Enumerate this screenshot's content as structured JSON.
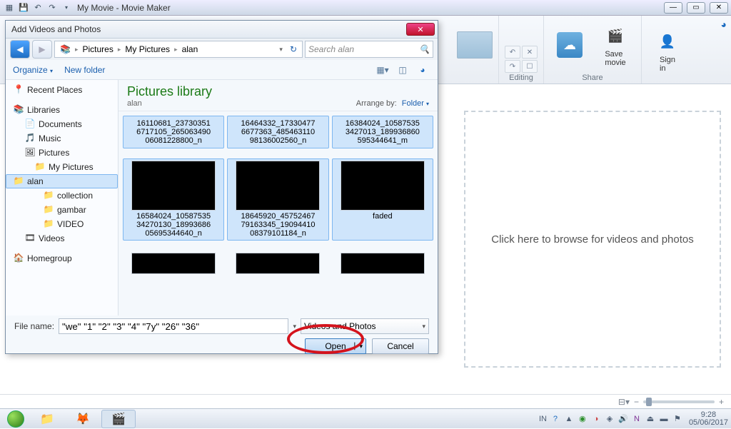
{
  "titlebar": {
    "title": "My Movie - Movie Maker"
  },
  "ribbon": {
    "editing_label": "Editing",
    "share_label": "Share",
    "save_movie": "Save\nmovie",
    "sign_in": "Sign\nin"
  },
  "hint": "Click here to browse for videos and photos",
  "dialog": {
    "title": "Add Videos and Photos",
    "breadcrumb": [
      "Pictures",
      "My Pictures",
      "alan"
    ],
    "search_placeholder": "Search alan",
    "organize": "Organize",
    "new_folder": "New folder",
    "library_title": "Pictures library",
    "library_sub": "alan",
    "arrange_label": "Arrange by:",
    "arrange_value": "Folder",
    "tree": [
      {
        "label": "Recent Places",
        "icon": "📍",
        "cls": ""
      },
      {
        "label": "",
        "icon": "",
        "cls": "",
        "gap": true
      },
      {
        "label": "Libraries",
        "icon": "📚",
        "cls": ""
      },
      {
        "label": "Documents",
        "icon": "📄",
        "cls": "tree-sub"
      },
      {
        "label": "Music",
        "icon": "🎵",
        "cls": "tree-sub"
      },
      {
        "label": "Pictures",
        "icon": "🖼",
        "cls": "tree-sub"
      },
      {
        "label": "My Pictures",
        "icon": "📁",
        "cls": "tree-sub2"
      },
      {
        "label": "alan",
        "icon": "📁",
        "cls": "tree-sub3",
        "selected": true
      },
      {
        "label": "collection",
        "icon": "📁",
        "cls": "tree-sub3"
      },
      {
        "label": "gambar",
        "icon": "📁",
        "cls": "tree-sub3"
      },
      {
        "label": "VIDEO",
        "icon": "📁",
        "cls": "tree-sub3"
      },
      {
        "label": "Videos",
        "icon": "🎞",
        "cls": "tree-sub"
      },
      {
        "label": "",
        "icon": "",
        "cls": "",
        "gap": true
      },
      {
        "label": "Homegroup",
        "icon": "🏠",
        "cls": ""
      }
    ],
    "thumbs_caption_row": [
      "16110681_237303516717105_26506349006081228800_n",
      "16464332_173304776677363_48546311098136002560_n",
      "16384024_105875353427013_189936860595344641_m"
    ],
    "thumbs": [
      {
        "name": "16584024_1058753534270130_1899368605695344640_n",
        "frame": "f1",
        "sel": true
      },
      {
        "name": "18645920_4575246779163345_1909441008379101184_n",
        "frame": "f2",
        "sel": true
      },
      {
        "name": "faded",
        "frame": "f3",
        "sel": true
      }
    ],
    "thumbs_partial": [
      {
        "frame": "f4"
      },
      {
        "frame": "f5"
      },
      {
        "frame": "f6"
      }
    ],
    "file_name_label": "File name:",
    "file_name_value": "\"we\" \"1\" \"2\" \"3\" \"4\" \"7y\" \"26\" \"36\"",
    "filter": "Videos and Photos",
    "open": "Open",
    "cancel": "Cancel"
  },
  "taskbar": {
    "lang": "IN",
    "time": "9:28",
    "date": "05/06/2017"
  }
}
